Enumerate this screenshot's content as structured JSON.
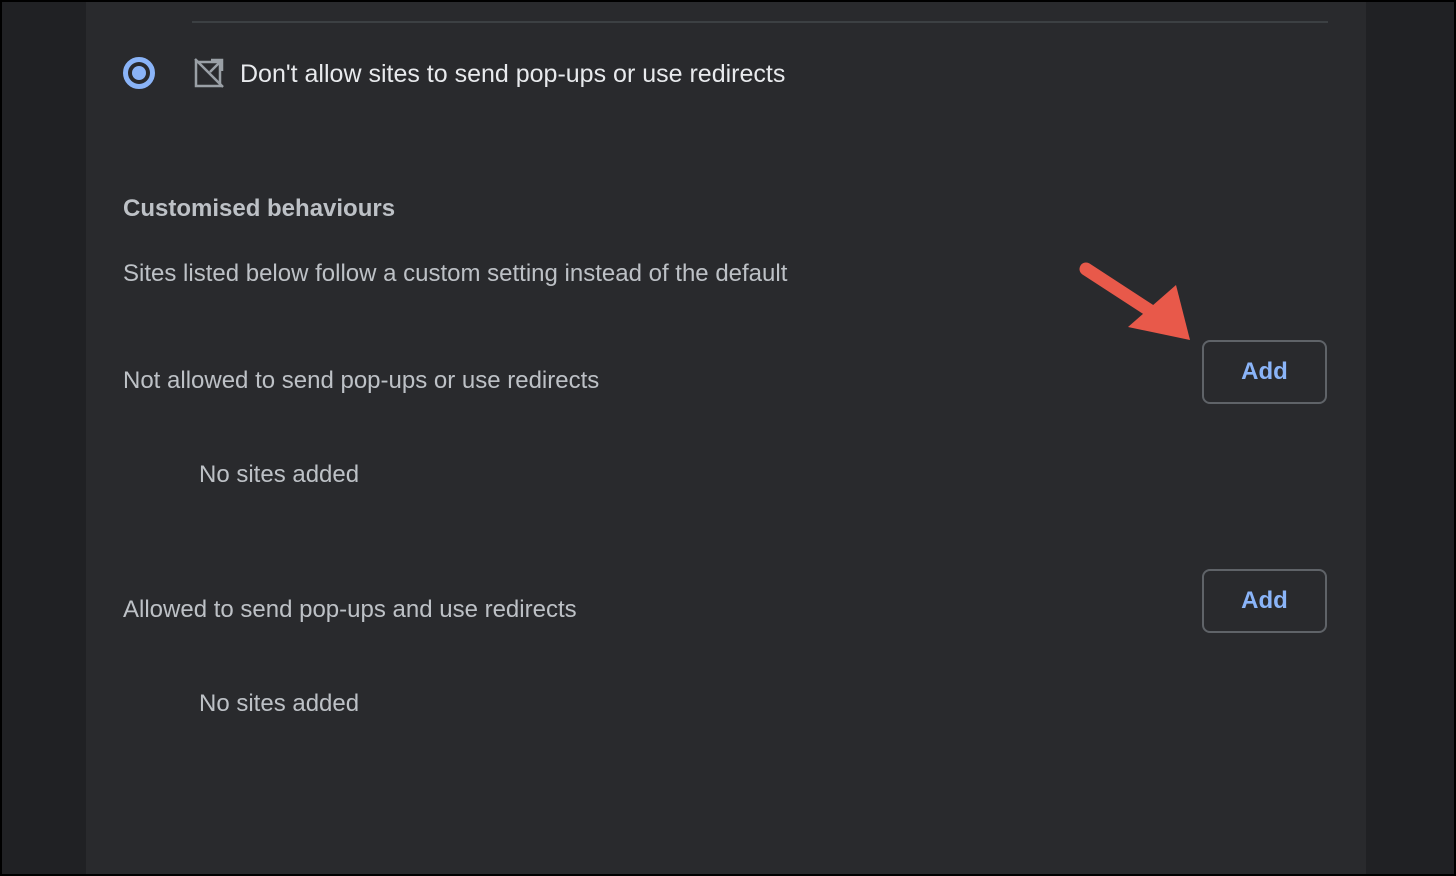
{
  "popups_setting": {
    "selected_option_label": "Don't allow sites to send pop-ups or use redirects",
    "selected_option_icon": "popup-blocked-icon"
  },
  "custom_behaviours": {
    "title": "Customised behaviours",
    "description": "Sites listed below follow a custom setting instead of the default",
    "not_allowed": {
      "label": "Not allowed to send pop-ups or use redirects",
      "add_label": "Add",
      "empty_text": "No sites added"
    },
    "allowed": {
      "label": "Allowed to send pop-ups and use redirects",
      "add_label": "Add",
      "empty_text": "No sites added"
    }
  },
  "colors": {
    "background": "#202124",
    "panel": "#292a2d",
    "accent": "#8ab4f8",
    "annotation_arrow": "#e8594a"
  }
}
